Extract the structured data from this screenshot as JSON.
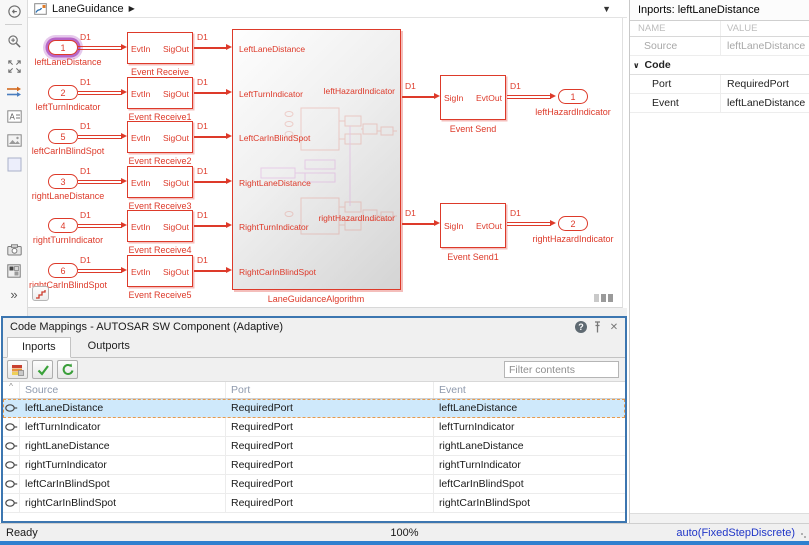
{
  "breadcrumb": {
    "model_name": "LaneGuidance"
  },
  "icons": {
    "breadcrumb_caret": "▶",
    "dropdown": "▼",
    "expand_toolbar": "»",
    "help": "?",
    "close": "✕",
    "collapse_header": "^",
    "code_section_chevron": "∨"
  },
  "canvas": {
    "rows": [
      {
        "port_num": "1",
        "inport_label": "leftLaneDistance",
        "signal": "D1",
        "block_name": "Event Receive",
        "block_in": "EvtIn",
        "block_out": "SigOut",
        "out_signal": "D1",
        "algo_input": "LeftLaneDistance",
        "selected": true
      },
      {
        "port_num": "2",
        "inport_label": "leftTurnIndicator",
        "signal": "D1",
        "block_name": "Event Receive1",
        "block_in": "EvtIn",
        "block_out": "SigOut",
        "out_signal": "D1",
        "algo_input": "LeftTurnIndicator",
        "selected": false
      },
      {
        "port_num": "5",
        "inport_label": "leftCarInBlindSpot",
        "signal": "D1",
        "block_name": "Event Receive2",
        "block_in": "EvtIn",
        "block_out": "SigOut",
        "out_signal": "D1",
        "algo_input": "LeftCarInBlindSpot",
        "selected": false
      },
      {
        "port_num": "3",
        "inport_label": "rightLaneDistance",
        "signal": "D1",
        "block_name": "Event Receive3",
        "block_in": "EvtIn",
        "block_out": "SigOut",
        "out_signal": "D1",
        "algo_input": "RightLaneDistance",
        "selected": false
      },
      {
        "port_num": "4",
        "inport_label": "rightTurnIndicator",
        "signal": "D1",
        "block_name": "Event Receive4",
        "block_in": "EvtIn",
        "block_out": "SigOut",
        "out_signal": "D1",
        "algo_input": "RightTurnIndicator",
        "selected": false
      },
      {
        "port_num": "6",
        "inport_label": "rightCarInBlindSpot",
        "signal": "D1",
        "block_name": "Event Receive5",
        "block_in": "EvtIn",
        "block_out": "SigOut",
        "out_signal": "D1",
        "algo_input": "RightCarInBlindSpot",
        "selected": false
      }
    ],
    "algorithm": {
      "label": "LaneGuidanceAlgorithm"
    },
    "outputs": [
      {
        "algo_output": "leftHazardIndicator",
        "signal": "D1",
        "send_name": "Event Send",
        "send_in": "SigIn",
        "send_out": "EvtOut",
        "out_signal": "D1",
        "port_num": "1",
        "outport_label": "leftHazardIndicator"
      },
      {
        "algo_output": "rightHazardIndicator",
        "signal": "D1",
        "send_name": "Event Send1",
        "send_in": "SigIn",
        "send_out": "EvtOut",
        "out_signal": "D1",
        "port_num": "2",
        "outport_label": "rightHazardIndicator"
      }
    ]
  },
  "inspector": {
    "title": "Inports: leftLaneDistance",
    "name_col": "NAME",
    "value_col": "VALUE",
    "rows": [
      {
        "name": "Source",
        "value": "leftLaneDistance",
        "muted": true,
        "section": false
      },
      {
        "name": "Code",
        "value": "",
        "muted": false,
        "section": true
      },
      {
        "name": "Port",
        "value": "RequiredPort",
        "muted": false,
        "section": false
      },
      {
        "name": "Event",
        "value": "leftLaneDistance",
        "muted": false,
        "section": false
      }
    ]
  },
  "code_mappings": {
    "title": "Code Mappings - AUTOSAR SW Component (Adaptive)",
    "tabs": [
      {
        "label": "Inports",
        "active": true
      },
      {
        "label": "Outports",
        "active": false
      }
    ],
    "filter_placeholder": "Filter contents",
    "columns": [
      "Source",
      "Port",
      "Event"
    ],
    "rows": [
      {
        "source": "leftLaneDistance",
        "port": "RequiredPort",
        "event": "leftLaneDistance",
        "selected": true
      },
      {
        "source": "leftTurnIndicator",
        "port": "RequiredPort",
        "event": "leftTurnIndicator",
        "selected": false
      },
      {
        "source": "rightLaneDistance",
        "port": "RequiredPort",
        "event": "rightLaneDistance",
        "selected": false
      },
      {
        "source": "rightTurnIndicator",
        "port": "RequiredPort",
        "event": "rightTurnIndicator",
        "selected": false
      },
      {
        "source": "leftCarInBlindSpot",
        "port": "RequiredPort",
        "event": "leftCarInBlindSpot",
        "selected": false
      },
      {
        "source": "rightCarInBlindSpot",
        "port": "RequiredPort",
        "event": "rightCarInBlindSpot",
        "selected": false
      }
    ]
  },
  "status_bar": {
    "ready": "Ready",
    "zoom": "100%",
    "solver": "auto(FixedStepDiscrete)"
  }
}
